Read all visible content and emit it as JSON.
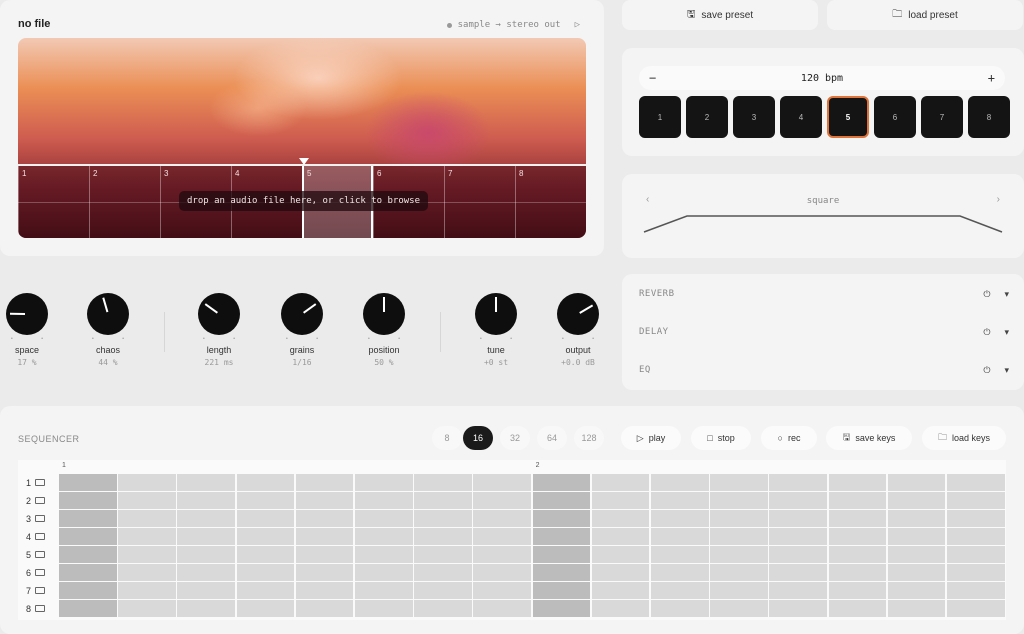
{
  "sample": {
    "file_name": "no file",
    "routing": "sample → stereo out",
    "drop_hint": "drop an audio file here, or click to browse",
    "slices": [
      "1",
      "2",
      "3",
      "4",
      "5",
      "6",
      "7",
      "8"
    ],
    "active_slice": 5
  },
  "presets": {
    "save_label": "save preset",
    "load_label": "load preset"
  },
  "tempo": {
    "minus": "−",
    "plus": "+",
    "value": "120 bpm",
    "pads": [
      "1",
      "2",
      "3",
      "4",
      "5",
      "6",
      "7",
      "8"
    ],
    "active_pad": 5
  },
  "envelope": {
    "shape": "square",
    "prev": "‹",
    "next": "›"
  },
  "fx": [
    {
      "label": "REVERB",
      "power": "⏻",
      "chevron": "▾"
    },
    {
      "label": "DELAY",
      "power": "⏻",
      "chevron": "▾"
    },
    {
      "label": "EQ",
      "power": "⏻",
      "chevron": "▾"
    }
  ],
  "knobs": [
    {
      "name": "space",
      "value": "17 %",
      "level": 0.17
    },
    {
      "name": "chaos",
      "value": "44 %",
      "level": 0.44
    },
    {
      "name": "length",
      "value": "221 ms",
      "level": 0.3
    },
    {
      "name": "grains",
      "value": "1/16",
      "level": 0.7
    },
    {
      "name": "position",
      "value": "50 %",
      "level": 0.5
    },
    {
      "name": "tune",
      "value": "+0 st",
      "level": 0.5
    },
    {
      "name": "output",
      "value": "+0.0 dB",
      "level": 0.72
    }
  ],
  "sequencer": {
    "title": "SEQUENCER",
    "lengths": [
      "8",
      "16",
      "32",
      "64",
      "128"
    ],
    "active_length": "16",
    "play": "play",
    "stop": "stop",
    "rec": "rec",
    "save_keys": "save keys",
    "load_keys": "load keys",
    "bar_labels": [
      "1",
      "2"
    ],
    "rows": [
      "1",
      "2",
      "3",
      "4",
      "5",
      "6",
      "7",
      "8"
    ],
    "steps": 16
  }
}
